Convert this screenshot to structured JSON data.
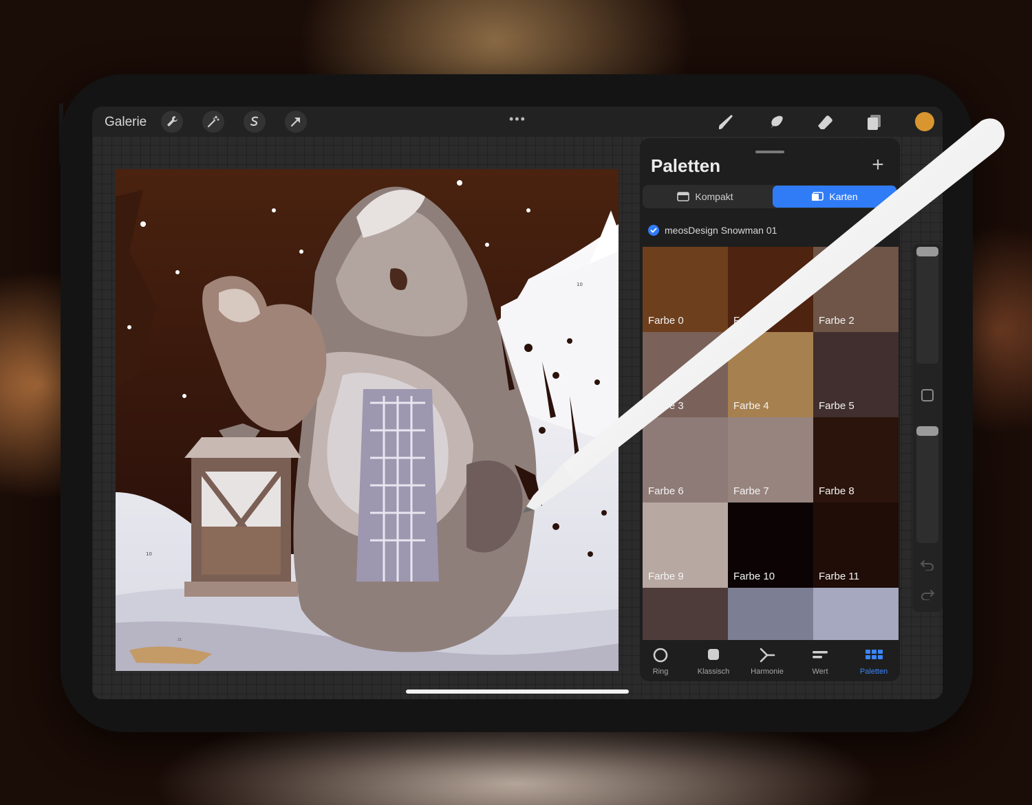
{
  "toolbar": {
    "gallery_label": "Galerie",
    "more_label": "•••",
    "current_color": "#d9962f"
  },
  "palette_panel": {
    "title": "Paletten",
    "add_label": "+",
    "views": [
      {
        "label": "Kompakt",
        "active": false
      },
      {
        "label": "Karten",
        "active": true
      }
    ],
    "palette_name": "meosDesign Snowman 01",
    "swatches": [
      {
        "label": "Farbe 0",
        "color": "#6e3f1d"
      },
      {
        "label": "Farbe 1",
        "color": "#4e230f"
      },
      {
        "label": "Farbe 2",
        "color": "#6e5548"
      },
      {
        "label": "Farbe 3",
        "color": "#7a615a"
      },
      {
        "label": "Farbe 4",
        "color": "#a7804f"
      },
      {
        "label": "Farbe 5",
        "color": "#402f2e"
      },
      {
        "label": "Farbe 6",
        "color": "#8e7a76"
      },
      {
        "label": "Farbe 7",
        "color": "#97847f"
      },
      {
        "label": "Farbe 8",
        "color": "#2b140b"
      },
      {
        "label": "Farbe 9",
        "color": "#b8a8a2"
      },
      {
        "label": "Farbe 10",
        "color": "#0c0404"
      },
      {
        "label": "Farbe 11",
        "color": "#200d08"
      },
      {
        "label": "",
        "color": "#4e3c3b"
      },
      {
        "label": "",
        "color": "#7c7e94"
      },
      {
        "label": "",
        "color": "#a6a8c0"
      }
    ],
    "tabs": [
      {
        "label": "Ring",
        "active": false
      },
      {
        "label": "Klassisch",
        "active": false
      },
      {
        "label": "Harmonie",
        "active": false
      },
      {
        "label": "Wert",
        "active": false
      },
      {
        "label": "Paletten",
        "active": true
      }
    ]
  },
  "canvas": {
    "numbers": [
      "10",
      "10",
      "21"
    ]
  },
  "colors": {
    "accent": "#2f7cf6"
  }
}
